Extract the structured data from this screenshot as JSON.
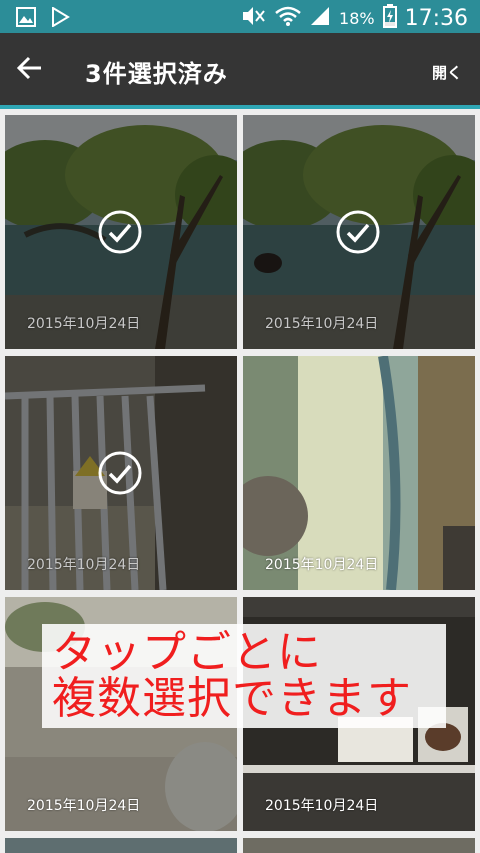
{
  "status_bar": {
    "battery": "18%",
    "time": "17:36",
    "icons": [
      "gallery-notification-icon",
      "play-store-notification-icon",
      "mute-icon",
      "wifi-icon",
      "signal-icon",
      "battery-charging-icon"
    ]
  },
  "action_bar": {
    "title": "3件選択済み",
    "open_label": "開く",
    "back_icon": "back-arrow-icon"
  },
  "photos": [
    {
      "date": "2015年10月24日",
      "selected": true
    },
    {
      "date": "2015年10月24日",
      "selected": true
    },
    {
      "date": "2015年10月24日",
      "selected": true
    },
    {
      "date": "2015年10月24日",
      "selected": false
    },
    {
      "date": "2015年10月24日",
      "selected": false
    },
    {
      "date": "2015年10月24日",
      "selected": false
    }
  ],
  "overlay": {
    "line1": "タップごとに",
    "line2": "複数選択できます"
  },
  "colors": {
    "status_bar": "#2c8d98",
    "action_bar": "#353535",
    "accent": "#2fa7b5",
    "overlay_text": "#f01e1e"
  }
}
